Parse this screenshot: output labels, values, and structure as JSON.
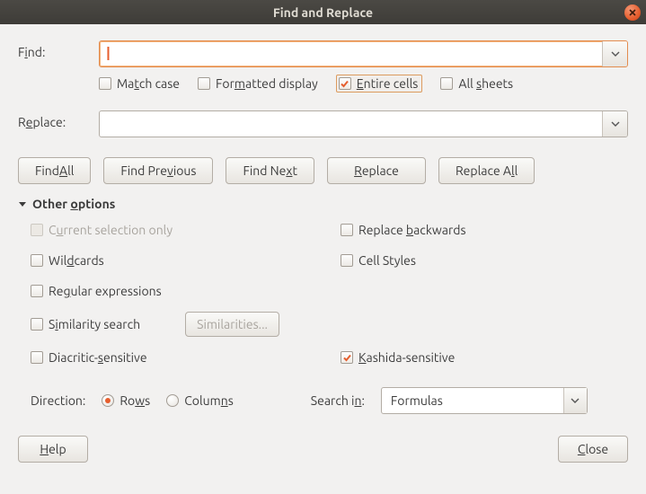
{
  "title": "Find and Replace",
  "find": {
    "label_pre": "F",
    "label_u": "i",
    "label_post": "nd:",
    "value": "",
    "options": {
      "match_case": {
        "pre": "Ma",
        "u": "t",
        "post": "ch case",
        "checked": false
      },
      "formatted": {
        "pre": "For",
        "u": "m",
        "post": "atted display",
        "checked": false
      },
      "entire": {
        "pre": "",
        "u": "E",
        "post": "ntire cells",
        "checked": true
      },
      "all_sheets": {
        "pre": "All ",
        "u": "s",
        "post": "heets",
        "checked": false
      }
    }
  },
  "replace": {
    "label_pre": "R",
    "label_u": "e",
    "label_post": "place:",
    "value": ""
  },
  "buttons": {
    "find_all": {
      "pre": "Find ",
      "u": "A",
      "post": "ll"
    },
    "find_prev": {
      "pre": "Find Pre",
      "u": "v",
      "post": "ious"
    },
    "find_next": {
      "pre": "Find Ne",
      "u": "x",
      "post": "t"
    },
    "replace": {
      "pre": "",
      "u": "R",
      "post": "eplace"
    },
    "replace_all": {
      "pre": "Replace A",
      "u": "l",
      "post": "l"
    }
  },
  "section": {
    "pre": "Other ",
    "u": "o",
    "post": "ptions"
  },
  "opts": {
    "cur_sel": {
      "pre": "C",
      "u": "u",
      "post": "rrent selection only",
      "checked": false,
      "disabled": true
    },
    "backwards": {
      "pre": "Replace ",
      "u": "b",
      "post": "ackwards",
      "checked": false
    },
    "wildcards": {
      "pre": "Wil",
      "u": "d",
      "post": "cards",
      "checked": false
    },
    "cell_styles": {
      "label": "Cell Styles",
      "checked": false
    },
    "regex": {
      "pre": "Re",
      "u": "g",
      "post": "ular expressions",
      "checked": false
    },
    "similarity": {
      "pre": "S",
      "u": "i",
      "post": "milarity search",
      "checked": false
    },
    "similarities_btn": "Similarities...",
    "diacritic": {
      "pre": "Diacritic-",
      "u": "s",
      "post": "ensitive",
      "checked": false
    },
    "kashida": {
      "pre": "",
      "u": "K",
      "post": "ashida-sensitive",
      "checked": true
    }
  },
  "direction": {
    "label": "Direction:",
    "rows": {
      "pre": "Ro",
      "u": "w",
      "post": "s",
      "selected": true
    },
    "cols": {
      "pre": "Colum",
      "u": "n",
      "post": "s",
      "selected": false
    }
  },
  "search_in": {
    "label_pre": "Search i",
    "label_u": "n",
    "label_post": ":",
    "value": "Formulas"
  },
  "footer": {
    "help": {
      "pre": "",
      "u": "H",
      "post": "elp"
    },
    "close": {
      "pre": "",
      "u": "C",
      "post": "lose"
    }
  }
}
